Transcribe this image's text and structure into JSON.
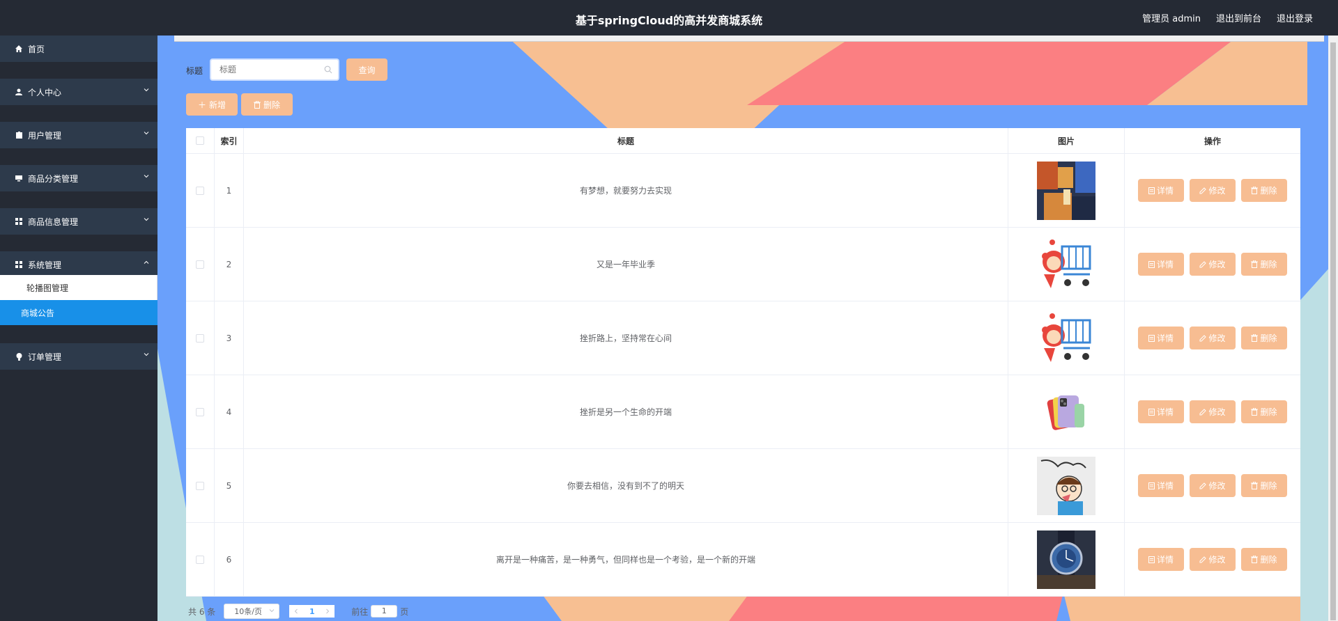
{
  "header": {
    "title": "基于springCloud的高并发商城系统",
    "user": "管理员 admin",
    "to_front": "退出到前台",
    "logout": "退出登录"
  },
  "sidebar": {
    "items": [
      {
        "label": "首页",
        "icon": "home-icon"
      },
      {
        "label": "个人中心",
        "icon": "user-icon"
      },
      {
        "label": "用户管理",
        "icon": "clipboard-icon"
      },
      {
        "label": "商品分类管理",
        "icon": "monitor-icon"
      },
      {
        "label": "商品信息管理",
        "icon": "grid-icon"
      },
      {
        "label": "系统管理",
        "icon": "grid-icon"
      },
      {
        "label": "订单管理",
        "icon": "bulb-icon"
      }
    ],
    "sub_items": [
      {
        "label": "轮播图管理"
      },
      {
        "label": "商城公告"
      }
    ]
  },
  "search": {
    "label": "标题",
    "placeholder": "标题",
    "query_button": "查询"
  },
  "toolbar": {
    "add_label": "新增",
    "delete_label": "删除"
  },
  "table": {
    "columns": [
      "索引",
      "标题",
      "图片",
      "操作"
    ],
    "rows": [
      {
        "index": "1",
        "title": "有梦想，就要努力去实现"
      },
      {
        "index": "2",
        "title": "又是一年毕业季"
      },
      {
        "index": "3",
        "title": "挫折路上，坚持常在心间"
      },
      {
        "index": "4",
        "title": "挫折是另一个生命的开端"
      },
      {
        "index": "5",
        "title": "你要去相信，没有到不了的明天"
      },
      {
        "index": "6",
        "title": "离开是一种痛苦，是一种勇气，但同样也是一个考验，是一个新的开端"
      }
    ],
    "ops": {
      "detail": "详情",
      "edit": "修改",
      "delete": "删除"
    }
  },
  "pager": {
    "total": "共 6 条",
    "page_size": "10条/页",
    "current": "1",
    "goto_prefix": "前往",
    "goto_value": "1",
    "goto_suffix": "页"
  },
  "colors": {
    "accent": "#f7bd92",
    "sidebar_bg": "#252a34",
    "menu_bg": "#2d3a4b",
    "active": "#1890e8"
  }
}
